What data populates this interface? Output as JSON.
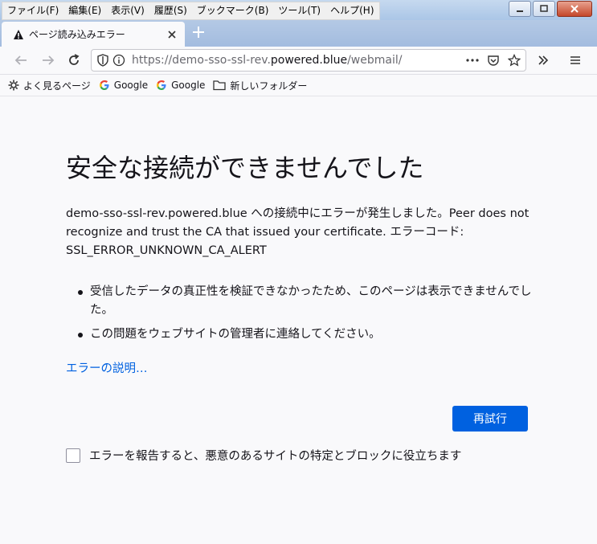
{
  "menu": {
    "items": [
      "ファイル(F)",
      "編集(E)",
      "表示(V)",
      "履歴(S)",
      "ブックマーク(B)",
      "ツール(T)",
      "ヘルプ(H)"
    ]
  },
  "tab": {
    "title": "ページ読み込みエラー",
    "icon": "warning-icon"
  },
  "urlbar": {
    "prefix": "https://demo-sso-ssl-rev.",
    "domain": "powered.blue",
    "suffix": "/webmail/"
  },
  "bookmarks": {
    "items": [
      {
        "label": "よく見るページ",
        "icon": "gear-icon"
      },
      {
        "label": "Google",
        "icon": "google-icon"
      },
      {
        "label": "Google",
        "icon": "google-icon"
      },
      {
        "label": "新しいフォルダー",
        "icon": "folder-icon"
      }
    ]
  },
  "error": {
    "title": "安全な接続ができませんでした",
    "description": "demo-sso-ssl-rev.powered.blue への接続中にエラーが発生しました。Peer does not recognize and trust the CA that issued your certificate. エラーコード: SSL_ERROR_UNKNOWN_CA_ALERT",
    "bullets": [
      "受信したデータの真正性を検証できなかったため、このページは表示できませんでした。",
      "この問題をウェブサイトの管理者に連絡してください。"
    ],
    "learn_more": "エラーの説明…",
    "retry_label": "再試行",
    "report_label": "エラーを報告すると、悪意のあるサイトの特定とブロックに役立ちます"
  },
  "colors": {
    "accent": "#0061e0",
    "text": "#15141a",
    "background": "#f9f9fb"
  }
}
